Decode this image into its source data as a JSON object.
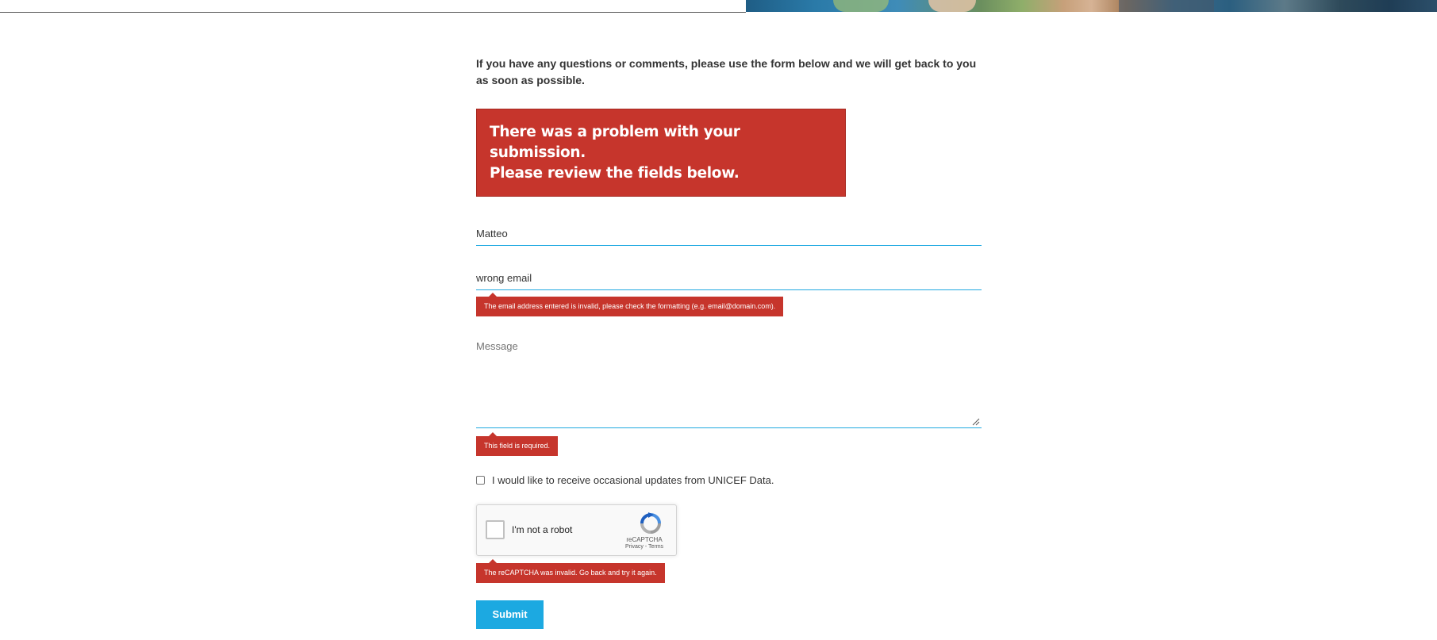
{
  "intro": {
    "text": "If you have any questions or comments, please use the form below and we will get back to you as soon as possible."
  },
  "error_banner": {
    "line1": "There was a problem with your submission.",
    "line2": "Please review the fields below."
  },
  "form": {
    "name": {
      "value": "Matteo"
    },
    "email": {
      "value": "wrong email",
      "error": "The email address entered is invalid, please check the formatting (e.g. email@domain.com)."
    },
    "message": {
      "placeholder": "Message",
      "value": "",
      "error": "This field is required."
    },
    "optin": {
      "label": "I would like to receive occasional updates from UNICEF Data.",
      "checked": false
    },
    "recaptcha": {
      "label": "I'm not a robot",
      "brand": "reCAPTCHA",
      "links": "Privacy - Terms",
      "error": "The reCAPTCHA was invalid. Go back and try it again."
    },
    "submit": {
      "label": "Submit"
    }
  },
  "colors": {
    "error": "#c6352c",
    "accent": "#1ca9e1",
    "field_underline": "#1fa9e1"
  }
}
